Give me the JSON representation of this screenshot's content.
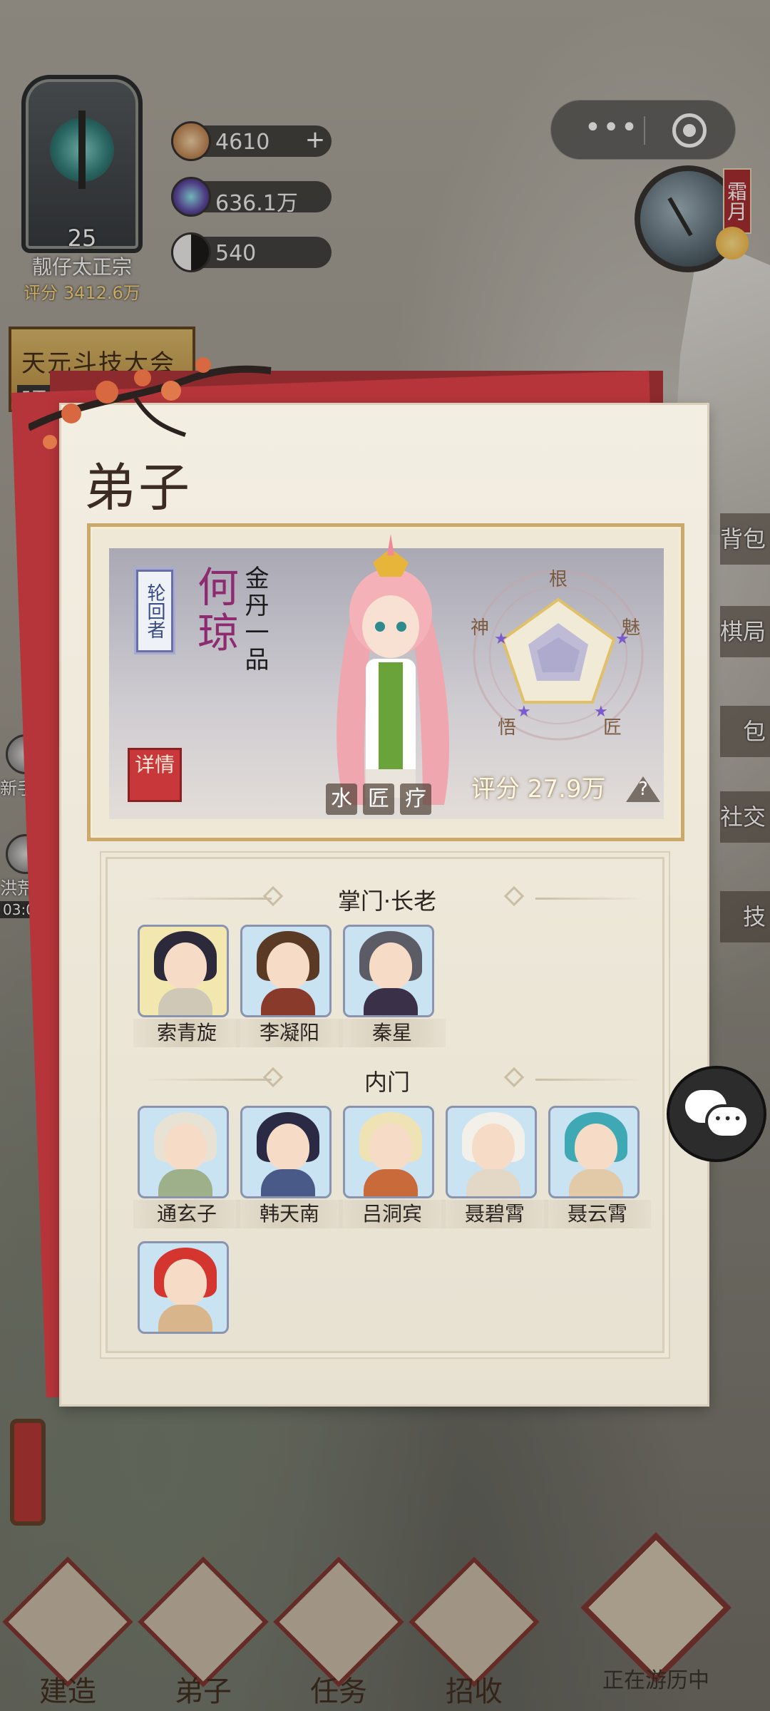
{
  "sect": {
    "level": "25",
    "name": "靓仔太正宗",
    "score": "评分 3412.6万"
  },
  "resources": [
    {
      "icon": "spirit-stone-icon",
      "value": "4610",
      "has_plus": true
    },
    {
      "icon": "crystal-icon",
      "value": "636.1万",
      "has_plus": false
    },
    {
      "icon": "yin-yang-icon",
      "value": "540",
      "has_plus": false
    }
  ],
  "capsule": {
    "more": "•••",
    "close": "close-miniprogram"
  },
  "dial": {
    "season": "霜月"
  },
  "event": {
    "title": "天元斗技大会",
    "time": "5天"
  },
  "left_side": [
    {
      "label": "新手"
    },
    {
      "label": "洪荒",
      "sub": "03:0"
    }
  ],
  "right_side": [
    "背包",
    "棋局",
    "包",
    "社交",
    "技"
  ],
  "panel": {
    "title": "弟子"
  },
  "featured": {
    "rank_tag": "轮回者",
    "name": "何琼",
    "realm": "金丹一品",
    "detail_label": "详情",
    "elements": [
      "水",
      "匠",
      "疗"
    ],
    "radar_labels": [
      "根",
      "魅",
      "匠",
      "悟",
      "神"
    ],
    "score": "评分 27.9万",
    "help": "?"
  },
  "sections": [
    {
      "title": "掌门·长老",
      "members": [
        {
          "name": "索青旋",
          "bg": "#f3e7b0",
          "hair": "#2c2a3a",
          "body": "#cfc8b6"
        },
        {
          "name": "李凝阳",
          "bg": "#c9e3f3",
          "hair": "#5a3a24",
          "body": "#8a3a2a"
        },
        {
          "name": "秦星",
          "bg": "#c9e3f3",
          "hair": "#5c5c66",
          "body": "#3a3048"
        }
      ]
    },
    {
      "title": "内门",
      "members": [
        {
          "name": "通玄子",
          "bg": "#c9e3f3",
          "hair": "#e8e2d4",
          "body": "#9eb08a"
        },
        {
          "name": "韩天南",
          "bg": "#c9e3f3",
          "hair": "#2a2a44",
          "body": "#4a5a88"
        },
        {
          "name": "吕洞宾",
          "bg": "#c9e3f3",
          "hair": "#efe2b4",
          "body": "#c96a3a"
        },
        {
          "name": "聂碧霄",
          "bg": "#c9e3f3",
          "hair": "#f3f0ea",
          "body": "#e3d7c6"
        },
        {
          "name": "聂云霄",
          "bg": "#c9e3f3",
          "hair": "#3ea9b4",
          "body": "#e2c9a8"
        },
        {
          "name": "",
          "bg": "#c9e3f3",
          "hair": "#d4352e",
          "body": "#d9b58c"
        }
      ]
    }
  ],
  "bottom_nav": [
    {
      "label": "建造"
    },
    {
      "label": "弟子"
    },
    {
      "label": "任务"
    },
    {
      "label": "招收"
    },
    {
      "label": "正在游历中"
    }
  ]
}
